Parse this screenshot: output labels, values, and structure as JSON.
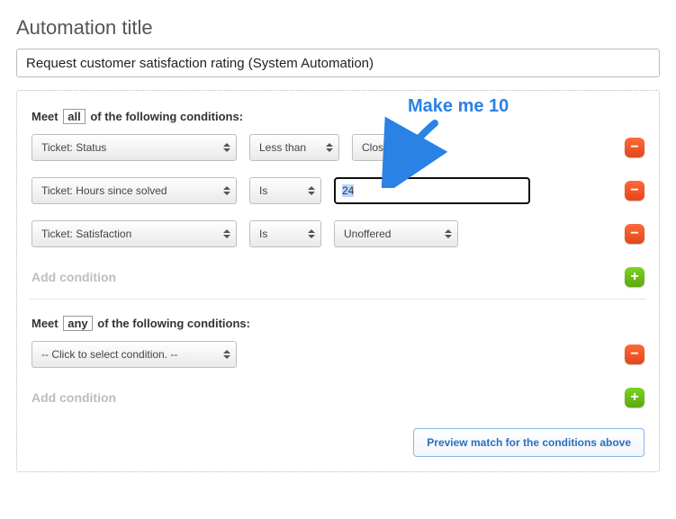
{
  "page_title": "Automation title",
  "automation_title_value": "Request customer satisfaction rating (System Automation)",
  "meet_all": {
    "prefix": "Meet",
    "mode": "all",
    "suffix": "of the following conditions:"
  },
  "meet_any": {
    "prefix": "Meet",
    "mode": "any",
    "suffix": "of the following conditions:"
  },
  "conditions_all": [
    {
      "field": "Ticket: Status",
      "operator": "Less than",
      "value": "Closed",
      "value_kind": "select_small"
    },
    {
      "field": "Ticket: Hours since solved",
      "operator": "Is",
      "value": "24",
      "value_kind": "number_input"
    },
    {
      "field": "Ticket: Satisfaction",
      "operator": "Is",
      "value": "Unoffered",
      "value_kind": "select_medium"
    }
  ],
  "conditions_any": [
    {
      "field": "-- Click to select condition. --",
      "operator": null,
      "value": null,
      "value_kind": null
    }
  ],
  "labels": {
    "add_condition": "Add condition",
    "preview_button": "Preview match for the conditions above"
  },
  "annotation": {
    "text": "Make me 10"
  }
}
